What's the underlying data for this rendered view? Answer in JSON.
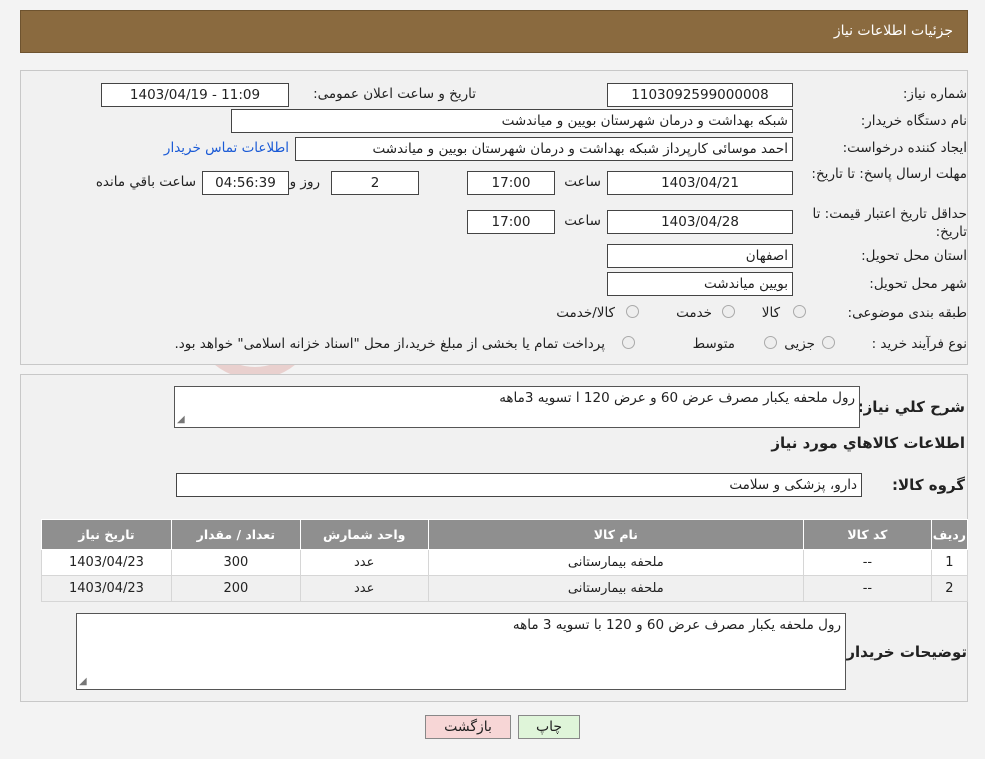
{
  "header": {
    "title": "جزئیات اطلاعات نیاز"
  },
  "fields": {
    "need_number_label": "شماره نیاز:",
    "need_number": "1103092599000008",
    "announce_label": "تاریخ و ساعت اعلان عمومی:",
    "announce_value": "1403/04/19 - 11:09",
    "buyer_org_label": "نام دستگاه خریدار:",
    "buyer_org": "شبکه بهداشت و درمان شهرستان بویین و میاندشت",
    "creator_label": "ایجاد کننده درخواست:",
    "creator": "احمد موسائی کارپرداز شبکه بهداشت و درمان شهرستان بویین و میاندشت",
    "contact_link": "اطلاعات تماس خریدار",
    "reply_deadline_label": "مهلت ارسال پاسخ: تا تاریخ:",
    "reply_date": "1403/04/21",
    "time_label": "ساعت",
    "reply_time": "17:00",
    "days_value": "2",
    "days_label": "روز و",
    "remaining_time": "04:56:39",
    "remaining_label": "ساعت باقي مانده",
    "price_validity_label": "حداقل تاریخ اعتبار قیمت: تا تاریخ:",
    "price_date": "1403/04/28",
    "price_time": "17:00",
    "province_label": "استان محل تحویل:",
    "province": "اصفهان",
    "city_label": "شهر محل تحویل:",
    "city": "بویین میاندشت",
    "category_label": "طبقه بندی موضوعی:",
    "category_options": [
      "کالا",
      "خدمت",
      "کالا/خدمت"
    ],
    "process_label": "نوع فرآیند خرید :",
    "process_options": [
      "جزیی",
      "متوسط"
    ],
    "process_note": "پرداخت تمام یا بخشی از مبلغ خرید،از محل \"اسناد خزانه اسلامی\" خواهد بود."
  },
  "details": {
    "summary_label": "شرح كلي نياز:",
    "summary": "رول ملحفه یکبار مصرف عرض 60 و عرض 120 ا تسویه 3ماهه",
    "items_title": "اطلاعات كالاهاي مورد نياز",
    "group_label": "گروه كالا:",
    "group_value": "دارو، پزشکی و سلامت",
    "columns": [
      "رديف",
      "کد کالا",
      "نام کالا",
      "واحد شمارش",
      "تعداد / مقدار",
      "تاریخ نیاز"
    ],
    "rows": [
      [
        "1",
        "--",
        "ملحفه بیمارستانی",
        "عدد",
        "300",
        "1403/04/23"
      ],
      [
        "2",
        "--",
        "ملحفه بیمارستانی",
        "عدد",
        "200",
        "1403/04/23"
      ]
    ],
    "buyer_notes_label": "توضیحات خریدار:",
    "buyer_notes": "رول ملحفه یکبار مصرف عرض 60 و 120 با تسویه 3 ماهه"
  },
  "buttons": {
    "print": "چاپ",
    "back": "بازگشت"
  },
  "colors": {
    "header": "#8a6a3f",
    "table_header": "#8f8f8f",
    "link": "#1a5ad6",
    "back_button": "#f7d6d6",
    "print_button": "#dff5d9"
  }
}
